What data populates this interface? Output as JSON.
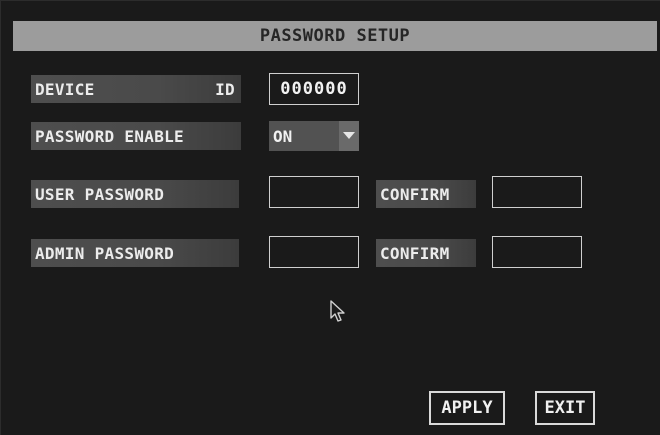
{
  "title": "PASSWORD SETUP",
  "device_id": {
    "label_left": "DEVICE",
    "label_right": "ID",
    "value": "000000"
  },
  "password_enable": {
    "label": "PASSWORD ENABLE",
    "value": "ON",
    "icon": "dropdown-arrow-icon"
  },
  "user_password": {
    "label": "USER PASSWORD",
    "value": "",
    "confirm_label": "CONFIRM",
    "confirm_value": ""
  },
  "admin_password": {
    "label": "ADMIN PASSWORD",
    "value": "",
    "confirm_label": "CONFIRM",
    "confirm_value": ""
  },
  "buttons": {
    "apply": "APPLY",
    "exit": "EXIT"
  },
  "colors": {
    "background": "#1a1a1a",
    "title_bar": "#9c9c9c",
    "label_bg": "#4a4a4a",
    "text": "#ececec"
  }
}
